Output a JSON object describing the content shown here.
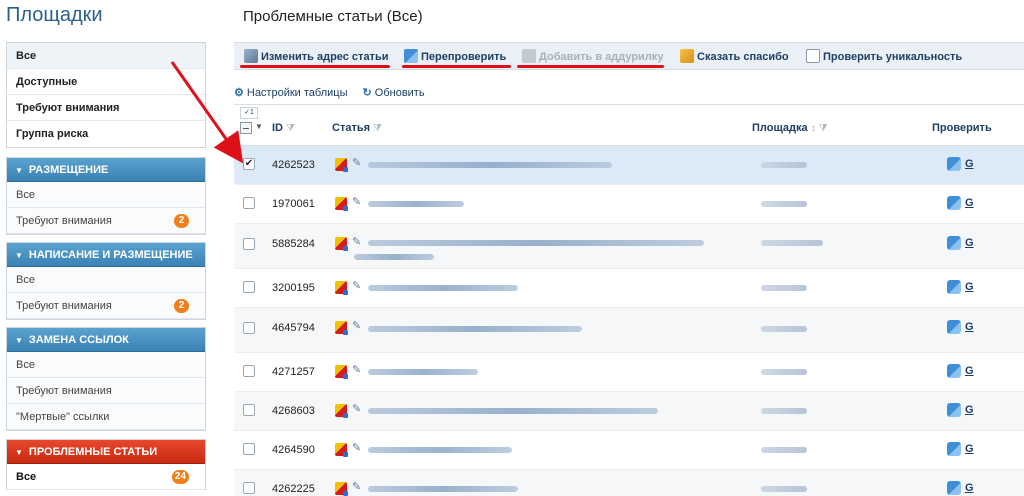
{
  "sidebar": {
    "title": "Площадки",
    "top_items": [
      {
        "label": "Все"
      },
      {
        "label": "Доступные"
      },
      {
        "label": "Требуют внимания"
      },
      {
        "label": "Группа риска"
      }
    ],
    "sections": [
      {
        "title": "РАЗМЕЩЕНИЕ",
        "items": [
          {
            "label": "Все"
          },
          {
            "label": "Требуют внимания",
            "badge": "2"
          }
        ]
      },
      {
        "title": "НАПИСАНИЕ И РАЗМЕЩЕНИЕ",
        "items": [
          {
            "label": "Все"
          },
          {
            "label": "Требуют внимания",
            "badge": "2"
          }
        ]
      },
      {
        "title": "ЗАМЕНА ССЫЛОК",
        "items": [
          {
            "label": "Все"
          },
          {
            "label": "Требуют внимания"
          },
          {
            "label": "\"Мертвые\" ссылки"
          }
        ]
      },
      {
        "title": "ПРОБЛЕМНЫЕ СТАТЬИ",
        "items": [
          {
            "label": "Все",
            "badge": "24"
          }
        ]
      }
    ]
  },
  "main": {
    "title": "Проблемные статьи (Все)",
    "toolbar": {
      "change_url": "Изменить адрес статьи",
      "recheck": "Перепроверить",
      "add_addurilka": "Добавить в аддурилку",
      "say_thanks": "Сказать спасибо",
      "check_unique": "Проверить уникальность"
    },
    "links": {
      "table_settings": "Настройки таблицы",
      "refresh": "Обновить"
    },
    "table": {
      "selected_count": "✓1",
      "headers": {
        "id": "ID",
        "article": "Статья",
        "site": "Площадка",
        "check": "Проверить"
      },
      "check_link": "G",
      "rows": [
        {
          "id": "4262523",
          "checked": true
        },
        {
          "id": "1970061",
          "checked": false
        },
        {
          "id": "5885284",
          "checked": false
        },
        {
          "id": "3200195",
          "checked": false
        },
        {
          "id": "4645794",
          "checked": false
        },
        {
          "id": "4271257",
          "checked": false
        },
        {
          "id": "4268603",
          "checked": false
        },
        {
          "id": "4264590",
          "checked": false
        },
        {
          "id": "4262225",
          "checked": false
        }
      ]
    }
  },
  "colors": {
    "accent_blue": "#3a82b4",
    "accent_red": "#c82a12",
    "badge_orange": "#ef7f1a",
    "annotation_red": "#e0101a",
    "selected_row": "#dbeaf6"
  }
}
